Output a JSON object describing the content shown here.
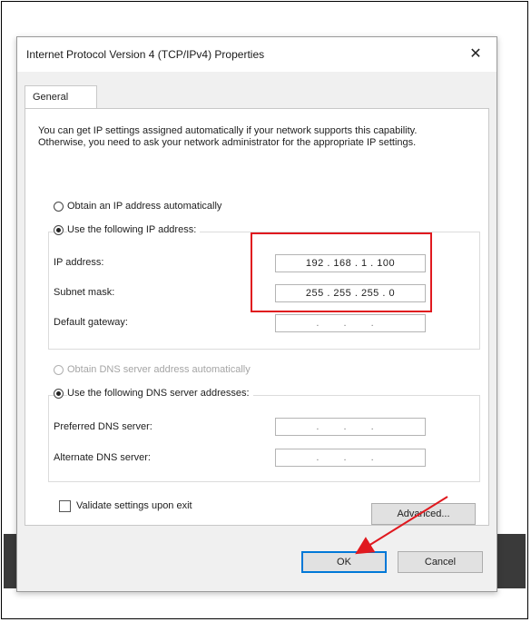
{
  "window": {
    "title": "Internet Protocol Version 4 (TCP/IPv4) Properties",
    "close_symbol": "✕"
  },
  "tabs": [
    {
      "label": "General"
    }
  ],
  "general": {
    "info_text": "You can get IP settings assigned automatically if your network supports this capability. Otherwise, you need to ask your network administrator for the appropriate IP settings.",
    "ip_mode": {
      "auto_label": "Obtain an IP address automatically",
      "manual_label": "Use the following IP address:",
      "selected": "manual"
    },
    "ip_fields": {
      "ip_address_label": "IP address:",
      "ip_address_value": "192 . 168 .  1  . 100",
      "subnet_mask_label": "Subnet mask:",
      "subnet_mask_value": "255 . 255 . 255 .  0",
      "gateway_label": "Default gateway:",
      "gateway_value": ".     .     ."
    },
    "dns_mode": {
      "auto_label": "Obtain DNS server address automatically",
      "manual_label": "Use the following DNS server addresses:",
      "selected": "manual",
      "auto_disabled": true
    },
    "dns_fields": {
      "preferred_label": "Preferred DNS server:",
      "preferred_value": ".     .     .",
      "alternate_label": "Alternate DNS server:",
      "alternate_value": ".     .     ."
    },
    "validate_label": "Validate settings upon exit",
    "validate_checked": false,
    "advanced_label": "Advanced..."
  },
  "footer": {
    "ok_label": "OK",
    "cancel_label": "Cancel"
  },
  "annotations": {
    "highlight_color": "#e0191f",
    "arrow_color": "#e0191f"
  }
}
